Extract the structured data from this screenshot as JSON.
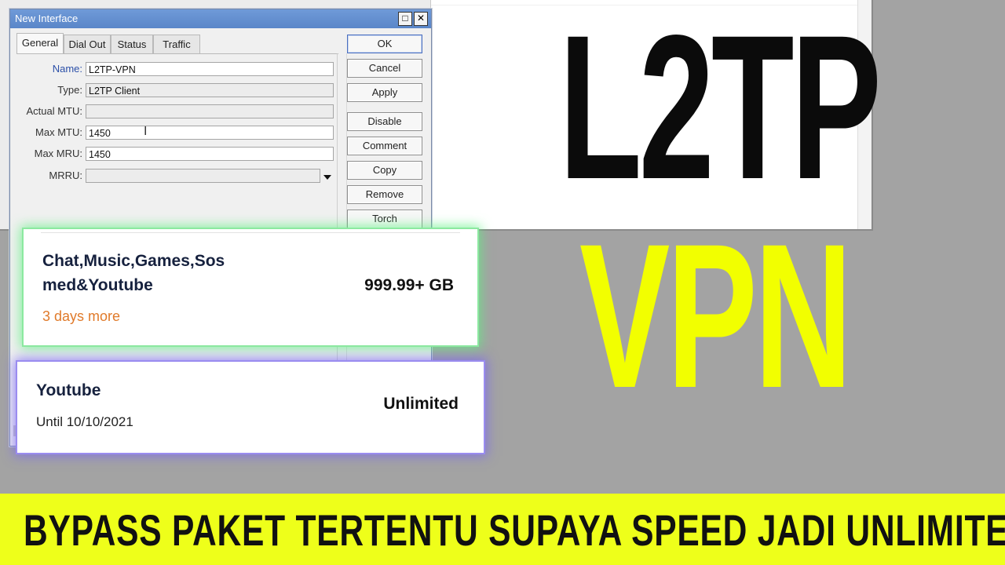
{
  "dialog": {
    "title": "New Interface",
    "title_buttons": {
      "restore": "□",
      "close": "✕"
    },
    "tabs": [
      "General",
      "Dial Out",
      "Status",
      "Traffic"
    ],
    "fields": {
      "name_label": "Name:",
      "name_value": "L2TP-VPN",
      "type_label": "Type:",
      "type_value": "L2TP Client",
      "actual_mtu_label": "Actual MTU:",
      "actual_mtu_value": "",
      "max_mtu_label": "Max MTU:",
      "max_mtu_value": "1450",
      "max_mru_label": "Max MRU:",
      "max_mru_value": "1450",
      "mrru_label": "MRRU:",
      "mrru_value": ""
    },
    "buttons": [
      "OK",
      "Cancel",
      "Apply",
      "Disable",
      "Comment",
      "Copy",
      "Remove",
      "Torch"
    ]
  },
  "cards": [
    {
      "title": "Chat,Music,Games,Sos\nmed&Youtube",
      "amount": "999.99+ GB",
      "subtitle": "3 days more"
    },
    {
      "title": "Youtube",
      "amount": "Unlimited",
      "subtitle": "Until 10/10/2021"
    }
  ],
  "headline": {
    "line1": "L2TP",
    "line2": "VPN"
  },
  "banner": {
    "text": "BYPASS PAKET TERTENTU SUPAYA SPEED JADI UNLIMITED"
  },
  "colors": {
    "headline_line1": "#0b0b0b",
    "headline_line2": "#f2ff00",
    "banner_bg": "#eeff1a",
    "card1_glow": "#5ff082",
    "card2_glow": "#7864f5",
    "subtitle_orange": "#e07a2a"
  }
}
